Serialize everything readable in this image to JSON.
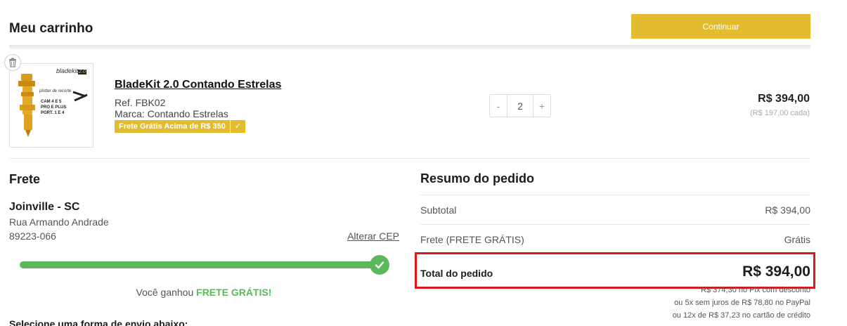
{
  "header": {
    "title": "Meu carrinho",
    "continue_label": "Continuar"
  },
  "colors": {
    "accent": "#e2bb2e",
    "success": "#5cb85c",
    "highlight_border": "#e0141b"
  },
  "cart_item": {
    "name": "BladeKit 2.0 Contando Estrelas",
    "ref": "Ref. FBK02",
    "brand": "Marca: Contando Estrelas",
    "badge": "Frete Grátis Acima de R$ 350",
    "badge_icon": "check-icon",
    "quantity": "2",
    "qty_minus": "-",
    "qty_plus": "+",
    "price_total": "R$ 394,00",
    "price_each": "(R$ 197,00 cada)",
    "image_text": {
      "logo": "bladekit",
      "logo_version": "2.0",
      "line1": "plotter de recorte",
      "line2": "CAM 4 E 5",
      "line3": "PRO E PLUS",
      "line4": "PORT. 1 E 4"
    }
  },
  "shipping": {
    "title": "Frete",
    "city": "Joinville - SC",
    "street": "Rua Armando Andrade",
    "cep": "89223-066",
    "change_cep": "Alterar CEP",
    "progress_fraction": 1.0,
    "won_prefix": "Você ganhou ",
    "won_highlight": "FRETE GRÁTIS!",
    "select_label": "Selecione uma forma de envio abaixo:"
  },
  "summary": {
    "title": "Resumo do pedido",
    "subtotal_label": "Subtotal",
    "subtotal_value": "R$ 394,00",
    "frete_label": "Frete (FRETE GRÁTIS)",
    "frete_value": "Grátis",
    "total_label": "Total do pedido",
    "total_value": "R$ 394,00",
    "pix": "R$ 374,30 no Pix com desconto",
    "paypal": "ou 5x sem juros de R$ 78,80 no PayPal",
    "card": "ou 12x de R$ 37,23 no cartão de crédito"
  }
}
